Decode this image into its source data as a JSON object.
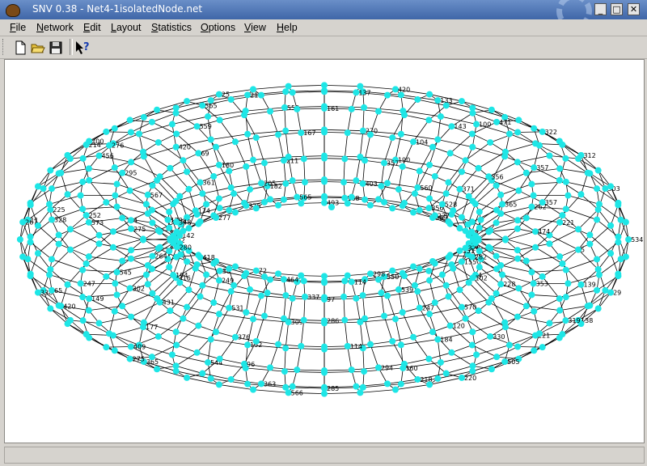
{
  "window": {
    "title": "SNV 0.38 - Net4-1isolatedNode.net",
    "controls": {
      "minimize": "_",
      "maximize": "□",
      "close": "✕"
    }
  },
  "menubar": {
    "items": [
      {
        "label": "File",
        "mnemonic": "F"
      },
      {
        "label": "Network",
        "mnemonic": "N"
      },
      {
        "label": "Edit",
        "mnemonic": "E"
      },
      {
        "label": "Layout",
        "mnemonic": "L"
      },
      {
        "label": "Statistics",
        "mnemonic": "S"
      },
      {
        "label": "Options",
        "mnemonic": "O"
      },
      {
        "label": "View",
        "mnemonic": "V"
      },
      {
        "label": "Help",
        "mnemonic": "H"
      }
    ]
  },
  "toolbar": {
    "buttons": [
      {
        "name": "new-file-icon"
      },
      {
        "name": "open-folder-icon"
      },
      {
        "name": "save-disk-icon"
      },
      {
        "name": "context-help-icon"
      }
    ]
  },
  "graph": {
    "node_color": "#1ee6e6",
    "edge_color": "#000000",
    "visible_node_labels": [
      "534",
      "365",
      "353",
      "262",
      "228",
      "221",
      "4",
      "29",
      "5",
      "155",
      "138",
      "139",
      "151",
      "121",
      "319",
      "320",
      "330",
      "282",
      "120",
      "102",
      "247",
      "505",
      "570",
      "539",
      "220",
      "184",
      "550",
      "218",
      "160",
      "298",
      "294",
      "114",
      "114",
      "97",
      "286",
      "285",
      "309",
      "337",
      "566",
      "152",
      "464",
      "363",
      "544",
      "72",
      "96",
      "30",
      "376",
      "316",
      "531",
      "365",
      "302",
      "249",
      "275",
      "149",
      "418",
      "409",
      "420",
      "192",
      "177",
      "275",
      "431",
      "573",
      "194",
      "338",
      "328",
      "280",
      "65",
      "11",
      "179",
      "247",
      "267",
      "567",
      "545",
      "295",
      "264",
      "456",
      "142",
      "225",
      "214",
      "174",
      "252",
      "200",
      "361",
      "4",
      "276",
      "69",
      "348",
      "559",
      "277",
      "565",
      "375",
      "420",
      "25",
      "182",
      "180",
      "213",
      "211",
      "205",
      "559",
      "167",
      "565",
      "161",
      "493",
      "137",
      "168",
      "270",
      "420",
      "403",
      "190",
      "133",
      "357",
      "560",
      "100",
      "104",
      "356",
      "143",
      "369",
      "471",
      "227",
      "357",
      "322",
      "528",
      "357",
      "312",
      "371",
      "474",
      "503",
      "556"
    ]
  }
}
